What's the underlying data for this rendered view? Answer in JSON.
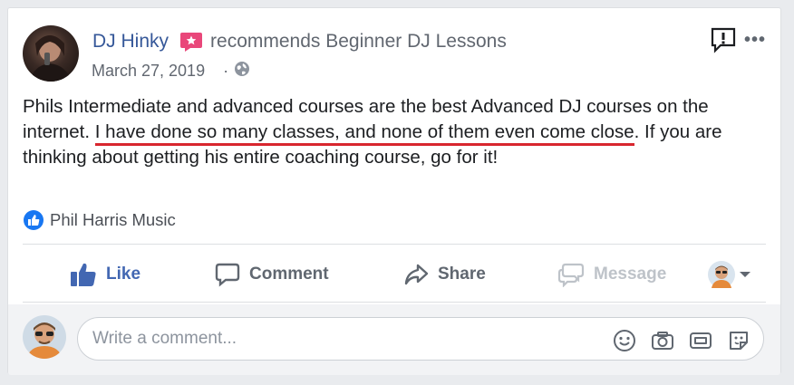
{
  "post": {
    "author": "DJ Hinky",
    "action": "recommends Beginner DJ Lessons",
    "date": "March 27, 2019",
    "separator": "·",
    "text_before": "Phils Intermediate and advanced courses are the best Advanced DJ courses on the internet. ",
    "text_highlight": "I have done so many classes, and none of them even come close",
    "text_after": ". If you are thinking about getting his entire coaching course, go for it!"
  },
  "reactions": {
    "liker": "Phil Harris Music"
  },
  "actions": {
    "like": "Like",
    "comment": "Comment",
    "share": "Share",
    "message": "Message"
  },
  "comment_box": {
    "placeholder": "Write a comment..."
  },
  "colors": {
    "link": "#365899",
    "like_blue": "#4267b2",
    "highlight_underline": "#d8262e",
    "recommend_pink": "#e9477a"
  },
  "icons": [
    "recommend-icon",
    "globe-icon",
    "report-icon",
    "more-icon",
    "like-thumb-icon",
    "comment-icon",
    "share-icon",
    "message-icon",
    "emoji-icon",
    "camera-icon",
    "gif-icon",
    "sticker-icon"
  ]
}
